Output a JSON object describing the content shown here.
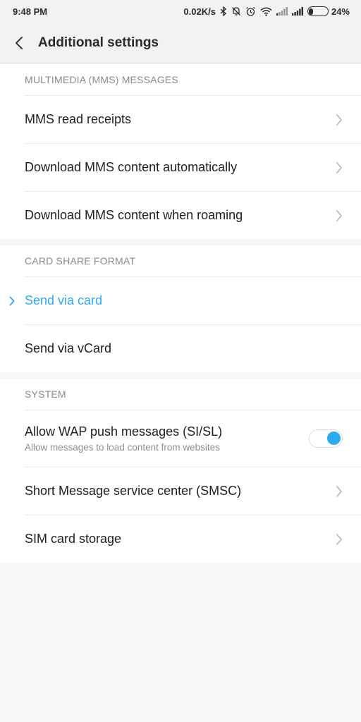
{
  "status_bar": {
    "time": "9:48 PM",
    "net_speed": "0.02K/s",
    "battery": "24%",
    "battery_level": 0.24
  },
  "header": {
    "title": "Additional settings"
  },
  "sections": {
    "mms": {
      "title": "MULTIMEDIA (MMS) MESSAGES",
      "items": [
        {
          "label": "MMS read receipts"
        },
        {
          "label": "Download MMS content automatically"
        },
        {
          "label": "Download MMS content when roaming"
        }
      ]
    },
    "card": {
      "title": "CARD SHARE FORMAT",
      "items": [
        {
          "label": "Send via card",
          "selected": true
        },
        {
          "label": "Send via vCard",
          "selected": false
        }
      ]
    },
    "system": {
      "title": "SYSTEM",
      "items": [
        {
          "label": "Allow WAP push messages (SI/SL)",
          "sublabel": "Allow messages to load content from websites",
          "toggle_on": true
        },
        {
          "label": "Short Message service center (SMSC)"
        },
        {
          "label": "SIM card storage"
        }
      ]
    }
  },
  "colors": {
    "accent": "#2ea8ef",
    "background": "#f7f7f7"
  },
  "icons": {
    "back": "chevron-left-icon",
    "row_arrow": "chevron-right-icon",
    "selected_mark": "chevron-right-icon"
  }
}
